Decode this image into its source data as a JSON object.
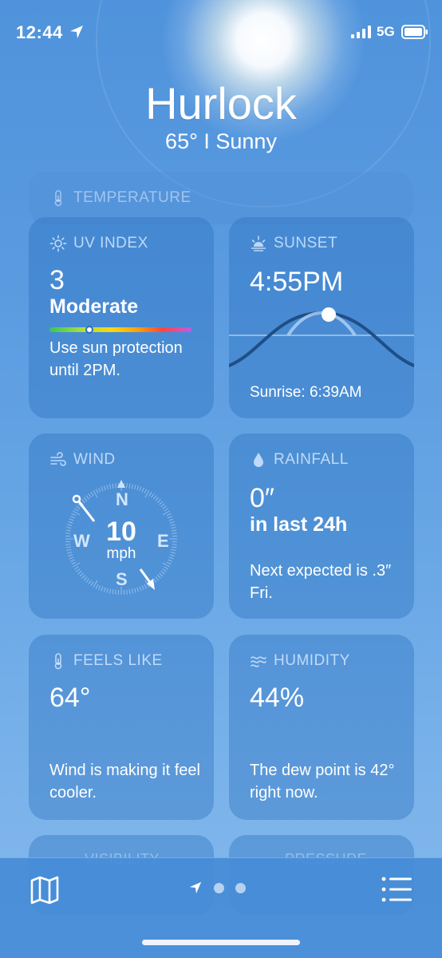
{
  "status": {
    "time": "12:44",
    "network": "5G"
  },
  "header": {
    "city": "Hurlock",
    "summary": "65°  I  Sunny"
  },
  "temperature": {
    "title": "TEMPERATURE"
  },
  "uv": {
    "title": "UV INDEX",
    "value": "3",
    "level": "Moderate",
    "level_fraction": 0.28,
    "desc": "Use sun protection until 2PM."
  },
  "sunset": {
    "title": "SUNSET",
    "time": "4:55PM",
    "sunrise": "Sunrise: 6:39AM"
  },
  "wind": {
    "title": "WIND",
    "speed": "10",
    "unit": "mph",
    "n": "N",
    "e": "E",
    "s": "S",
    "w": "W"
  },
  "rain": {
    "title": "RAINFALL",
    "value": "0″",
    "period": "in last 24h",
    "desc": "Next expected is .3″ Fri."
  },
  "feels": {
    "title": "FEELS LIKE",
    "value": "64°",
    "desc": "Wind is making it feel cooler."
  },
  "humidity": {
    "title": "HUMIDITY",
    "value": "44%",
    "desc": "The dew point is 42° right now."
  },
  "visibility": {
    "title": "VISIBILITY"
  },
  "pressure": {
    "title": "PRESSURE"
  },
  "icons": [
    "location-arrow-icon",
    "signal-icon",
    "battery-icon",
    "thermometer-icon",
    "sun-icon",
    "sunset-icon",
    "wind-icon",
    "raindrop-icon",
    "humidity-icon",
    "map-icon",
    "list-icon"
  ],
  "colors": {
    "bg_top": "#4f93dc",
    "bg_bottom": "#84b8ec",
    "card": "rgba(40,110,190,0.38)"
  }
}
